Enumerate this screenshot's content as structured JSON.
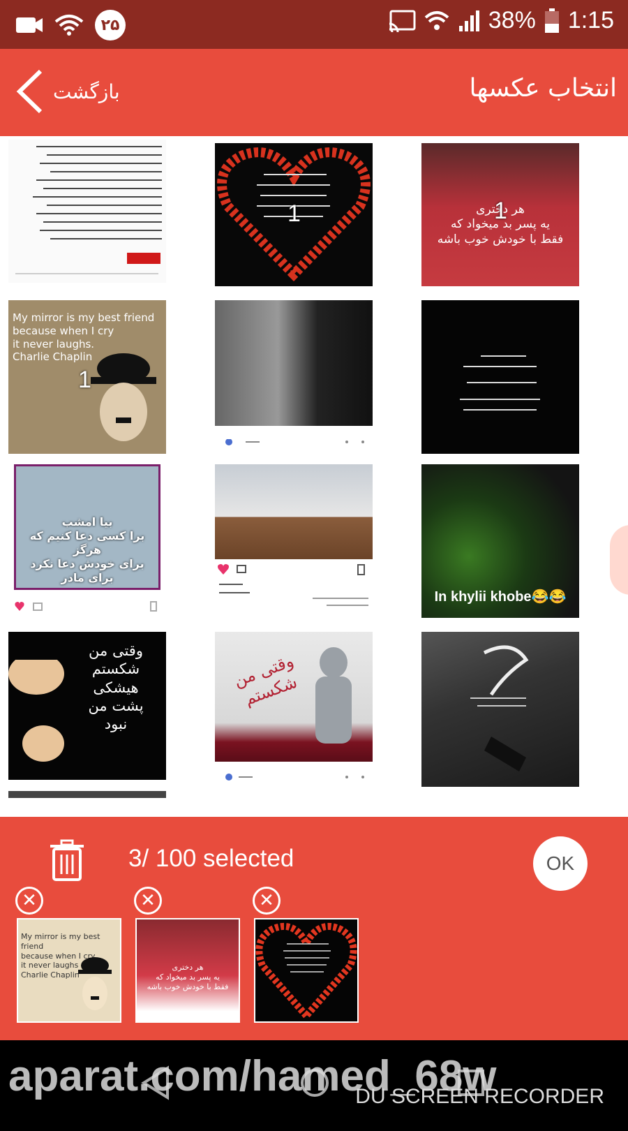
{
  "status_bar": {
    "notification_badge": "۲۵",
    "battery": "38%",
    "time": "1:15",
    "icons": [
      "video-camera-icon",
      "wifi-icon",
      "cast-icon",
      "signal-icon",
      "battery-icon"
    ]
  },
  "app_bar": {
    "title": "انتخاب عکسها",
    "back_label": "بازگشت"
  },
  "grid": {
    "tiles": [
      {
        "text": "",
        "selected_number": ""
      },
      {
        "text": "",
        "selected_number": "1"
      },
      {
        "text": "هر دختری\nیه پسر بد میخواد که\nفقط با خودش خوب باشه",
        "selected_number": "1"
      },
      {
        "text": "My mirror is my best friend\nbecause when I cry\nit never laughs.\nCharlie Chaplin",
        "selected_number": "1"
      },
      {
        "text": "",
        "selected_number": ""
      },
      {
        "text": "",
        "selected_number": ""
      },
      {
        "text": "بیا امشب\nبرا کسی دعا کنیم که هرگز\nبرای خودش دعا نکرد\nبرای مادر",
        "selected_number": ""
      },
      {
        "text": "",
        "selected_number": ""
      },
      {
        "text": "In khylii khobe😂😂",
        "selected_number": ""
      },
      {
        "text": "وقتی من شکستم\nهیشکی\nپشت من\nنبود",
        "selected_number": ""
      },
      {
        "text": "وقتی من شکستم",
        "selected_number": ""
      },
      {
        "text": "",
        "selected_number": ""
      }
    ]
  },
  "selection": {
    "count_text": "3/ 100 selected",
    "ok_label": "OK"
  },
  "selected_thumbs": [
    {
      "text": "My mirror is my best friend\nbecause when I cry\nit never laughs\nCharlie Chaplin"
    },
    {
      "text": "هر دختری\nیه پسر بد میخواد که\nفقط با خودش خوب باشه"
    },
    {
      "text": ""
    }
  ],
  "nav_bar": {
    "watermark": "aparat.com/hamed_68w",
    "recorder": "DU SCREEN RECORDER"
  },
  "colors": {
    "primary": "#e84c3d",
    "status_bar": "#8c2a21"
  }
}
